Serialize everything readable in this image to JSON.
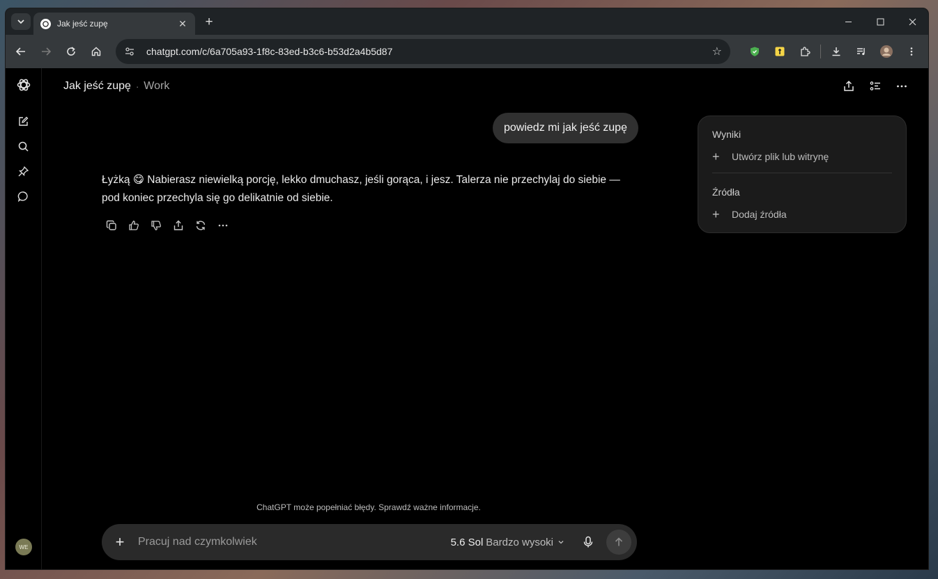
{
  "browser": {
    "tab_title": "Jak jeść zupę",
    "url": "chatgpt.com/c/6a705a93-1f8c-83ed-b3c6-b53d2a4b5d87"
  },
  "header": {
    "title": "Jak jeść zupę",
    "separator": "·",
    "project": "Work"
  },
  "conversation": {
    "user_message": "powiedz mi jak jeść zupę",
    "assistant_message": "Łyżką 😋 Nabierasz niewielką porcję, lekko dmuchasz, jeśli gorąca, i jesz. Talerza nie przechylaj do siebie — pod koniec przechyla się go delikatnie od siebie."
  },
  "side_panel": {
    "results_heading": "Wyniki",
    "results_action": "Utwórz plik lub witrynę",
    "sources_heading": "Źródła",
    "sources_action": "Dodaj źródła"
  },
  "composer": {
    "disclaimer": "ChatGPT może popełniać błędy. Sprawdź ważne informacje.",
    "placeholder": "Pracuj nad czymkolwiek",
    "model": "5.6 Sol",
    "effort": "Bardzo wysoki"
  },
  "user": {
    "initials": "WE"
  },
  "colors": {
    "background": "#000000",
    "bubble": "#303030",
    "composer": "#2a2a2a",
    "panel": "#1b1b1b"
  }
}
